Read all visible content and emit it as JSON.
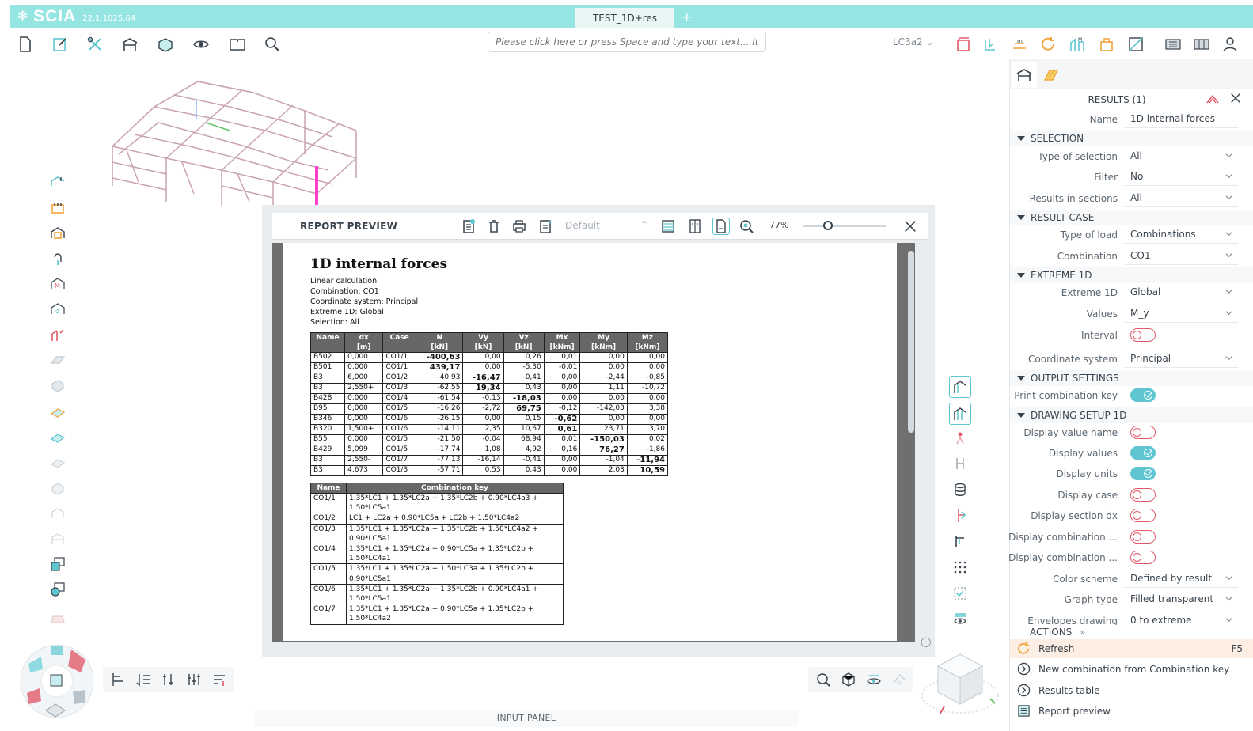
{
  "app": {
    "logo": "SCIA",
    "version": "22.1.1025.64",
    "document_tab": "TEST_1D+res",
    "add_tab_icon": "+"
  },
  "toolbar": {
    "command_placeholder": "Please click here or press Space and type your text... It will be ...",
    "load_case": "LC3a2"
  },
  "report_preview": {
    "title": "REPORT PREVIEW",
    "template": "Default",
    "zoom": "77%",
    "zoom_value": 0.3,
    "page": {
      "heading": "1D internal forces",
      "meta": [
        "Linear  calculation",
        "Combination:  CO1",
        "Coordinate  system:  Principal",
        "Extreme  1D:  Global",
        "Selection:  All"
      ],
      "forces_table": {
        "headers": [
          {
            "top": "Name",
            "unit": ""
          },
          {
            "top": "dx",
            "unit": "[m]"
          },
          {
            "top": "Case",
            "unit": ""
          },
          {
            "top": "N",
            "unit": "[kN]"
          },
          {
            "top": "Vy",
            "unit": "[kN]"
          },
          {
            "top": "Vz",
            "unit": "[kN]"
          },
          {
            "top": "Mx",
            "unit": "[kNm]"
          },
          {
            "top": "My",
            "unit": "[kNm]"
          },
          {
            "top": "Mz",
            "unit": "[kNm]"
          }
        ],
        "rows": [
          [
            "B502",
            "0,000",
            "CO1/1",
            "-400,63",
            "0,00",
            "0,26",
            "0,01",
            "0,00",
            "0,00"
          ],
          [
            "B501",
            "0,000",
            "CO1/1",
            "439,17",
            "0,00",
            "-5,30",
            "-0,01",
            "0,00",
            "0,00"
          ],
          [
            "B3",
            "6,000",
            "CO1/2",
            "-40,93",
            "-16,47",
            "-0,41",
            "0,00",
            "-2,44",
            "-0,85"
          ],
          [
            "B3",
            "2,550+",
            "CO1/3",
            "-62,55",
            "19,34",
            "0,43",
            "0,00",
            "1,11",
            "-10,72"
          ],
          [
            "B428",
            "0,000",
            "CO1/4",
            "-61,54",
            "-0,13",
            "-18,03",
            "0,00",
            "0,00",
            "0,00"
          ],
          [
            "B95",
            "0,000",
            "CO1/5",
            "-16,26",
            "-2,72",
            "69,75",
            "-0,12",
            "-142,03",
            "3,38"
          ],
          [
            "B346",
            "0,000",
            "CO1/6",
            "-26,15",
            "0,00",
            "0,15",
            "-0,62",
            "0,00",
            "0,00"
          ],
          [
            "B320",
            "1,500+",
            "CO1/6",
            "-14,11",
            "2,35",
            "10,67",
            "0,61",
            "23,71",
            "3,70"
          ],
          [
            "B55",
            "0,000",
            "CO1/5",
            "-21,50",
            "-0,04",
            "68,94",
            "0,01",
            "-150,03",
            "0,02"
          ],
          [
            "B429",
            "5,099",
            "CO1/5",
            "-17,74",
            "1,08",
            "4,92",
            "0,16",
            "76,27",
            "-1,86"
          ],
          [
            "B3",
            "2,550-",
            "CO1/7",
            "-77,13",
            "-16,14",
            "-0,41",
            "0,00",
            "-1,04",
            "-11,94"
          ],
          [
            "B3",
            "4,673",
            "CO1/3",
            "-57,71",
            "0,53",
            "0,43",
            "0,00",
            "2,03",
            "10,59"
          ]
        ],
        "bold_cells": [
          [
            0,
            3
          ],
          [
            1,
            3
          ],
          [
            2,
            4
          ],
          [
            3,
            4
          ],
          [
            4,
            5
          ],
          [
            5,
            5
          ],
          [
            6,
            6
          ],
          [
            7,
            6
          ],
          [
            8,
            7
          ],
          [
            9,
            7
          ],
          [
            10,
            8
          ],
          [
            11,
            8
          ]
        ]
      },
      "combo_table": {
        "headers": [
          "Name",
          "Combination  key"
        ],
        "rows": [
          [
            "CO1/1",
            "1.35*LC1  +  1.35*LC2a  +  1.35*LC2b  +  0.90*LC4a3  +",
            "1.50*LC5a1"
          ],
          [
            "CO1/2",
            "LC1  +  LC2a  +  0.90*LC5a  +  LC2b  +  1.50*LC4a2",
            ""
          ],
          [
            "CO1/3",
            "1.35*LC1  +  1.35*LC2a  +  1.35*LC2b  +  1.50*LC4a2  +",
            "0.90*LC5a1"
          ],
          [
            "CO1/4",
            "1.35*LC1  +  1.35*LC2a  +  0.90*LC5a  +  1.35*LC2b  +",
            "1.50*LC4a1"
          ],
          [
            "CO1/5",
            "1.35*LC1  +  1.35*LC2a  +  1.50*LC3a  +  1.35*LC2b  +",
            "0.90*LC5a1"
          ],
          [
            "CO1/6",
            "1.35*LC1  +  1.35*LC2a  +  1.35*LC2b  +  0.90*LC4a1  +",
            "1.50*LC5a1"
          ],
          [
            "CO1/7",
            "1.35*LC1  +  1.35*LC2a  +  0.90*LC5a  +  1.35*LC2b  +",
            "1.50*LC4a2"
          ]
        ]
      }
    }
  },
  "properties": {
    "results_title": "RESULTS (1)",
    "name_label": "Name",
    "name_value": "1D internal forces",
    "sections": {
      "selection": "SELECTION",
      "result_case": "RESULT CASE",
      "extreme_1d": "EXTREME 1D",
      "output_settings": "OUTPUT SETTINGS",
      "drawing_setup": "DRAWING SETUP 1D"
    },
    "rows": {
      "type_of_selection": {
        "label": "Type of selection",
        "value": "All"
      },
      "filter": {
        "label": "Filter",
        "value": "No"
      },
      "results_in_sections": {
        "label": "Results in sections",
        "value": "All"
      },
      "type_of_load": {
        "label": "Type of load",
        "value": "Combinations"
      },
      "combination": {
        "label": "Combination",
        "value": "CO1"
      },
      "extreme_1d": {
        "label": "Extreme 1D",
        "value": "Global"
      },
      "values": {
        "label": "Values",
        "value": "M_y"
      },
      "interval": {
        "label": "Interval"
      },
      "coordinate_system": {
        "label": "Coordinate system",
        "value": "Principal"
      },
      "print_combination_key": {
        "label": "Print combination key"
      },
      "display_value_name": {
        "label": "Display value name"
      },
      "display_values": {
        "label": "Display values"
      },
      "display_units": {
        "label": "Display units"
      },
      "display_case": {
        "label": "Display case"
      },
      "display_section_dx": {
        "label": "Display section dx"
      },
      "display_combination_1": {
        "label": "Display combination ..."
      },
      "display_combination_2": {
        "label": "Display combination ..."
      },
      "color_scheme": {
        "label": "Color scheme",
        "value": "Defined by result"
      },
      "graph_type": {
        "label": "Graph type",
        "value": "Filled transparent"
      },
      "envelopes_drawing": {
        "label": "Envelopes drawing",
        "value": "0 to extreme"
      }
    },
    "actions": {
      "label": "ACTIONS",
      "refresh": "Refresh",
      "refresh_shortcut": "F5",
      "new_combination": "New combination from Combination key",
      "results_table": "Results table",
      "report_preview": "Report preview"
    }
  },
  "bottom": {
    "input_panel": "INPUT PANEL"
  },
  "colors": {
    "titlebar": "#95e6e2",
    "accent": "#5fc6d1",
    "toggle_off": "#e15b6a",
    "model_members": "#c9a3ad",
    "highlight_member": "#ff3fd2"
  }
}
